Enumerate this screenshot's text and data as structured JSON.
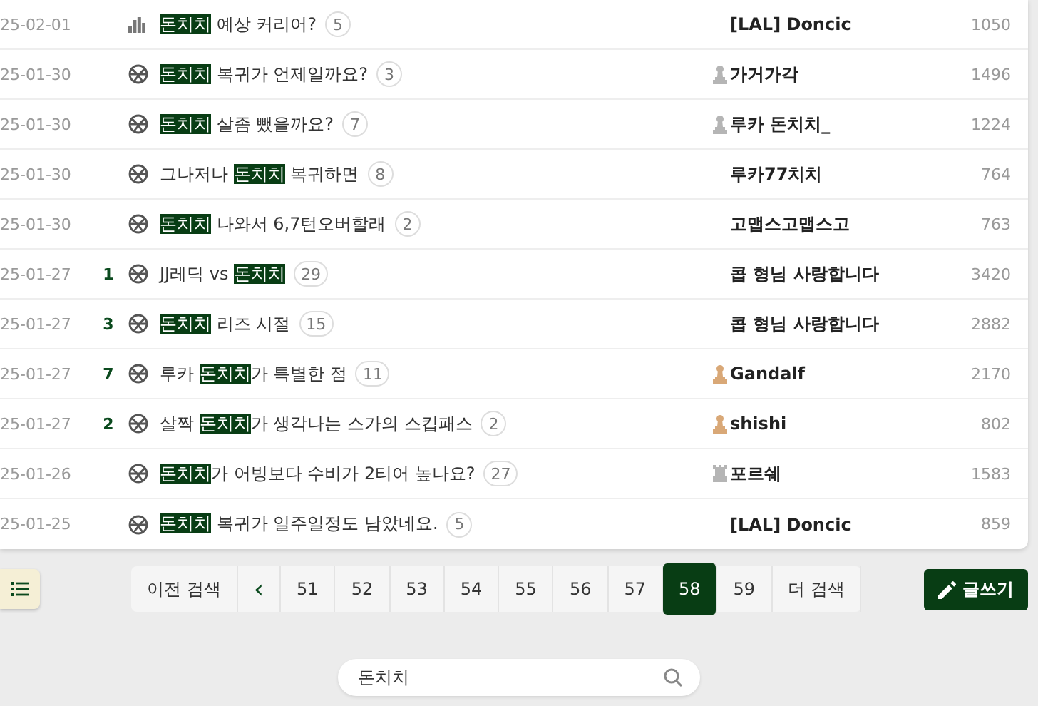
{
  "posts": [
    {
      "date": "25-02-01",
      "icon": {
        "kind": "chart"
      },
      "title": [
        {
          "text": "돈치치",
          "hit": true
        },
        {
          "text": " 예상 커리어?",
          "hit": false
        }
      ],
      "comments": "5",
      "author": "[LAL] Doncic",
      "views": "1050"
    },
    {
      "date": "25-01-30",
      "icon": {
        "kind": "ball"
      },
      "title": [
        {
          "text": "돈치치",
          "hit": true
        },
        {
          "text": " 복귀가 언제일까요?",
          "hit": false
        }
      ],
      "comments": "3",
      "badge": {
        "kind": "silver"
      },
      "author": "가거가각",
      "views": "1496"
    },
    {
      "date": "25-01-30",
      "icon": {
        "kind": "ball"
      },
      "title": [
        {
          "text": "돈치치",
          "hit": true
        },
        {
          "text": " 살좀 뺐을까요?",
          "hit": false
        }
      ],
      "comments": "7",
      "badge": {
        "kind": "silver"
      },
      "author": "루카 돈치치_",
      "views": "1224"
    },
    {
      "date": "25-01-30",
      "icon": {
        "kind": "ball"
      },
      "title": [
        {
          "text": "그나저나 ",
          "hit": false
        },
        {
          "text": "돈치치",
          "hit": true
        },
        {
          "text": " 복귀하면",
          "hit": false
        }
      ],
      "comments": "8",
      "author": "루카77치치",
      "views": "764"
    },
    {
      "date": "25-01-30",
      "icon": {
        "kind": "ball"
      },
      "title": [
        {
          "text": "돈치치",
          "hit": true
        },
        {
          "text": " 나와서 6,7턴오버할래",
          "hit": false
        }
      ],
      "comments": "2",
      "author": "고맵스고맵스고",
      "views": "763"
    },
    {
      "date": "25-01-27",
      "rank": "1",
      "icon": {
        "kind": "ball"
      },
      "title": [
        {
          "text": "JJ레딕 vs ",
          "hit": false
        },
        {
          "text": "돈치치",
          "hit": true
        }
      ],
      "comments": "29",
      "author": "콥 형님 사랑합니다",
      "views": "3420"
    },
    {
      "date": "25-01-27",
      "rank": "3",
      "icon": {
        "kind": "ball"
      },
      "title": [
        {
          "text": "돈치치",
          "hit": true
        },
        {
          "text": " 리즈 시절",
          "hit": false
        }
      ],
      "comments": "15",
      "author": "콥 형님 사랑합니다",
      "views": "2882"
    },
    {
      "date": "25-01-27",
      "rank": "7",
      "icon": {
        "kind": "ball"
      },
      "title": [
        {
          "text": "루카 ",
          "hit": false
        },
        {
          "text": "돈치치",
          "hit": true
        },
        {
          "text": "가 특별한 점",
          "hit": false
        }
      ],
      "comments": "11",
      "badge": {
        "kind": "bronze"
      },
      "author": "Gandalf",
      "views": "2170"
    },
    {
      "date": "25-01-27",
      "rank": "2",
      "icon": {
        "kind": "ball"
      },
      "title": [
        {
          "text": "살짝 ",
          "hit": false
        },
        {
          "text": "돈치치",
          "hit": true
        },
        {
          "text": "가 생각나는 스가의 스킵패스",
          "hit": false
        }
      ],
      "comments": "2",
      "badge": {
        "kind": "bronze"
      },
      "author": "shishi",
      "views": "802"
    },
    {
      "date": "25-01-26",
      "icon": {
        "kind": "ball"
      },
      "title": [
        {
          "text": "돈치치",
          "hit": true
        },
        {
          "text": "가 어빙보다 수비가 2티어 높나요?",
          "hit": false
        }
      ],
      "comments": "27",
      "badge": {
        "kind": "tower"
      },
      "author": "포르쉐",
      "views": "1583"
    },
    {
      "date": "25-01-25",
      "icon": {
        "kind": "ball"
      },
      "title": [
        {
          "text": "돈치치",
          "hit": true
        },
        {
          "text": " 복귀가 일주일정도 남았네요.",
          "hit": false
        }
      ],
      "comments": "5",
      "author": "[LAL] Doncic",
      "views": "859"
    }
  ],
  "pagination": {
    "prev_search": "이전 검색",
    "prev": "‹",
    "pages": [
      {
        "label": "51",
        "selected": false
      },
      {
        "label": "52",
        "selected": false
      },
      {
        "label": "53",
        "selected": false
      },
      {
        "label": "54",
        "selected": false
      },
      {
        "label": "55",
        "selected": false
      },
      {
        "label": "56",
        "selected": false
      },
      {
        "label": "57",
        "selected": false
      },
      {
        "label": "58",
        "selected": true
      },
      {
        "label": "59",
        "selected": false
      }
    ],
    "next_search": "더 검색"
  },
  "write_button": "글쓰기",
  "search": {
    "value": "돈치치"
  }
}
